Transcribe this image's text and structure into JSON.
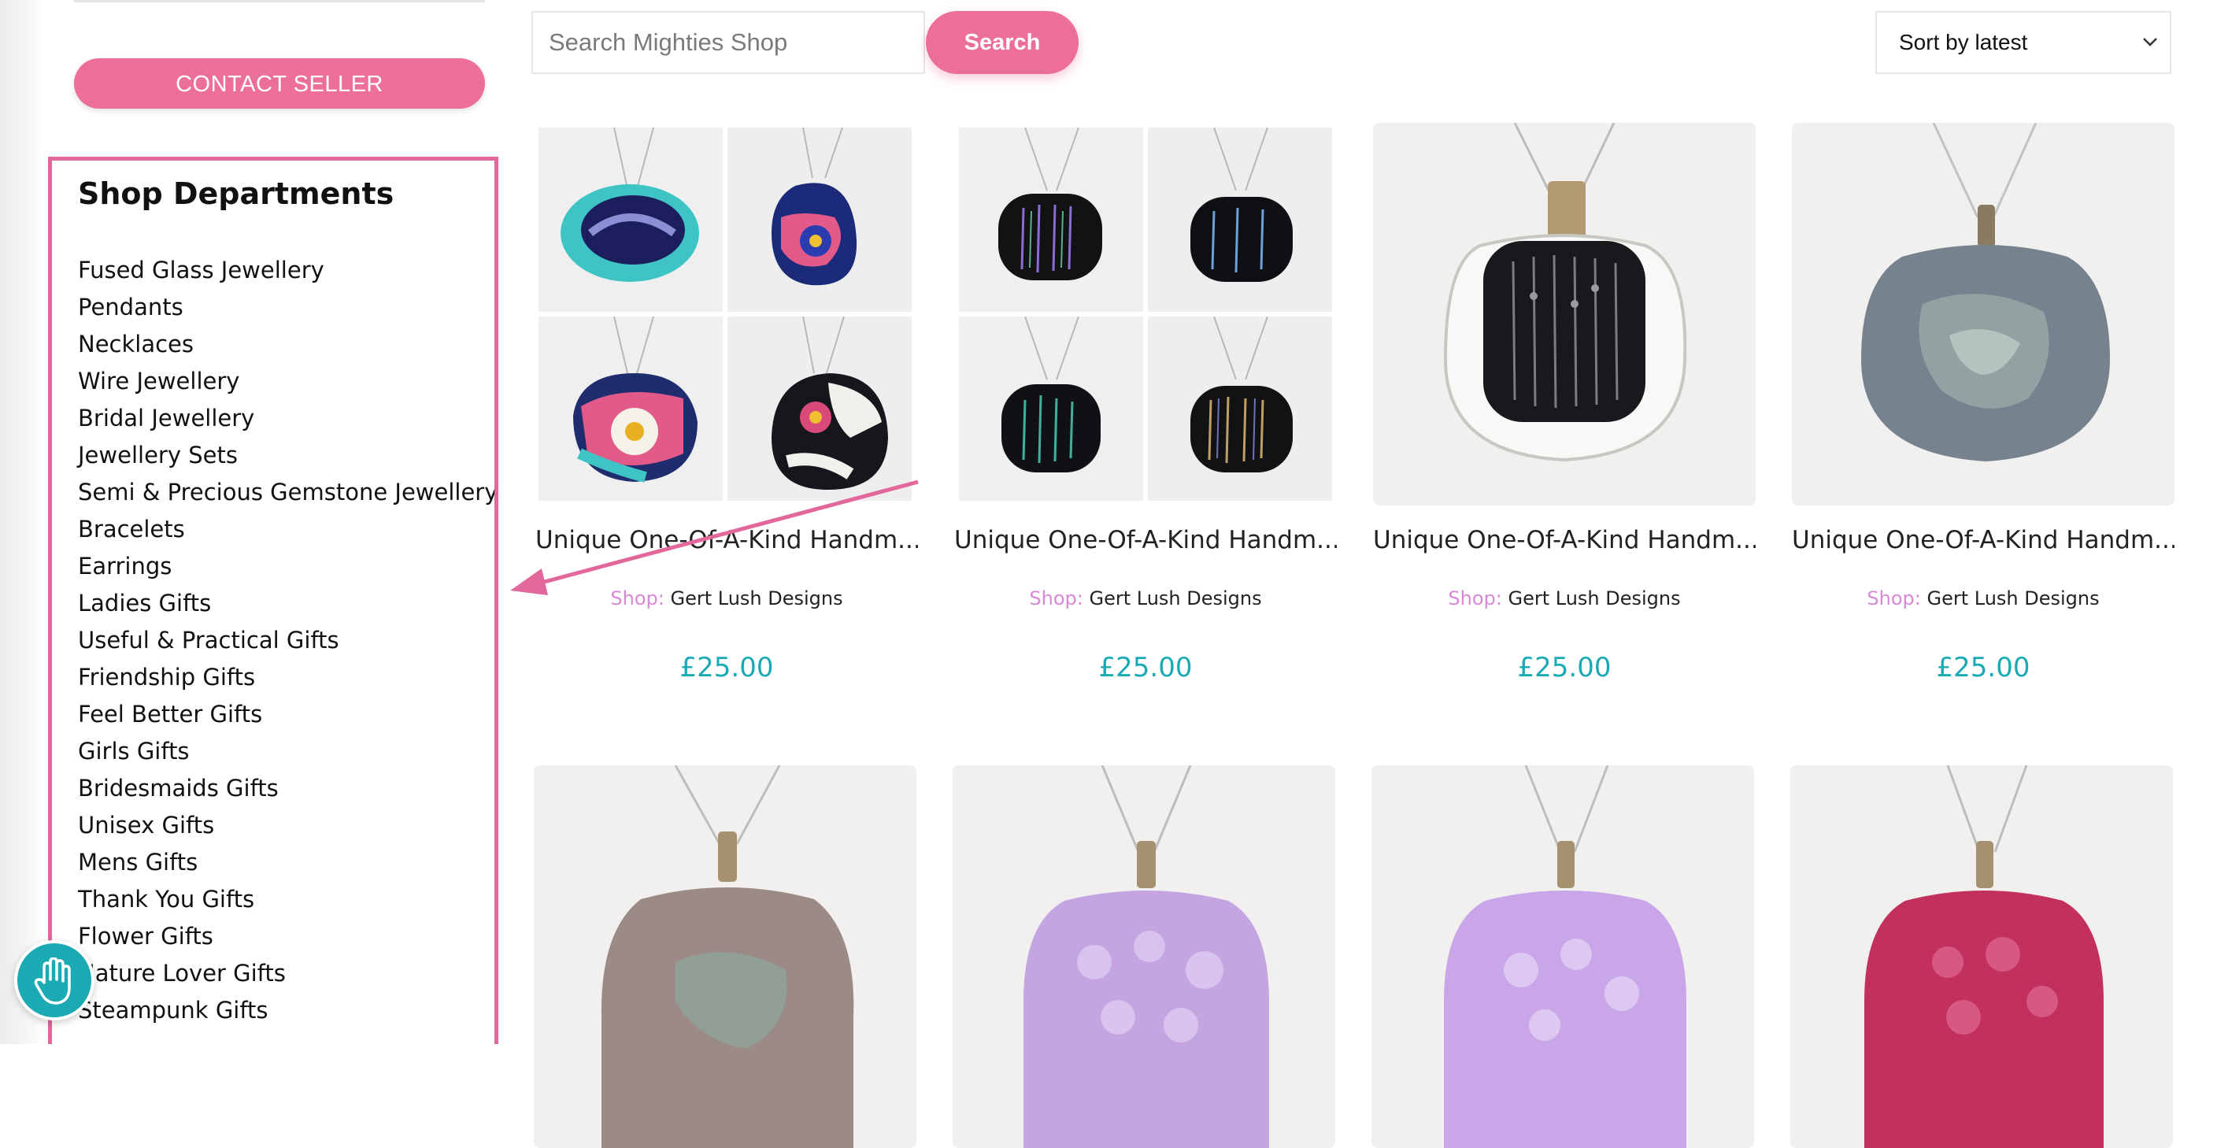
{
  "sidebar": {
    "contact_label": "CONTACT SELLER",
    "departments_title": "Shop Departments",
    "departments": [
      "Fused Glass Jewellery",
      "Pendants",
      "Necklaces",
      "Wire Jewellery",
      "Bridal Jewellery",
      "Jewellery Sets",
      "Semi & Precious Gemstone Jewellery",
      "Bracelets",
      "Earrings",
      "Ladies Gifts",
      "Useful & Practical Gifts",
      "Friendship Gifts",
      "Feel Better Gifts",
      "Girls Gifts",
      "Bridesmaids Gifts",
      "Unisex Gifts",
      "Mens Gifts",
      "Thank You Gifts",
      "Flower Gifts",
      "Nature Lover Gifts",
      "Steampunk Gifts"
    ]
  },
  "search": {
    "placeholder": "Search Mighties Shop",
    "button_label": "Search"
  },
  "sort": {
    "selected": "Sort by latest"
  },
  "shop_label": "Shop:",
  "products": [
    {
      "title": "Unique One-Of-A-Kind Handm...",
      "shop": "Gert Lush Designs",
      "price": "£25.00"
    },
    {
      "title": "Unique One-Of-A-Kind Handm...",
      "shop": "Gert Lush Designs",
      "price": "£25.00"
    },
    {
      "title": "Unique One-Of-A-Kind Handm...",
      "shop": "Gert Lush Designs",
      "price": "£25.00"
    },
    {
      "title": "Unique One-Of-A-Kind Handm...",
      "shop": "Gert Lush Designs",
      "price": "£25.00"
    },
    {},
    {},
    {},
    {}
  ],
  "colors": {
    "accent_pink": "#ec6f9a",
    "highlight_border": "#e2679a",
    "price_teal": "#19aab4",
    "shop_label": "#d889d6"
  },
  "icons": {
    "help": "hand-icon",
    "sort": "chevron-down-icon"
  }
}
